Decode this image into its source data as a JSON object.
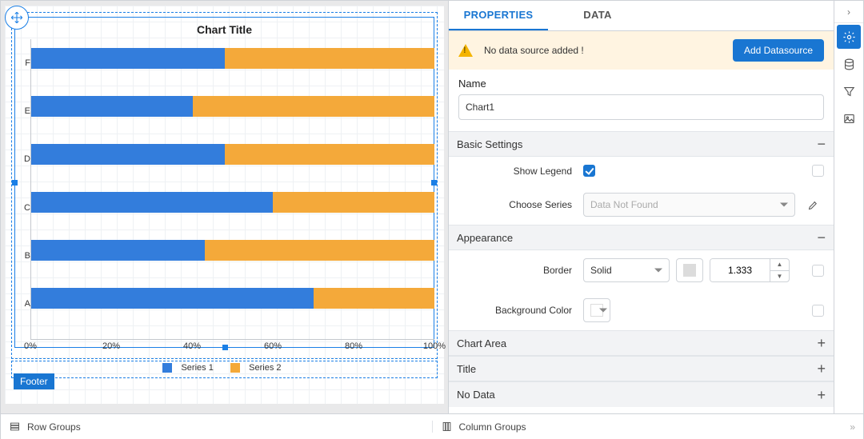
{
  "tabs": {
    "properties": "PROPERTIES",
    "data": "DATA"
  },
  "alert": {
    "message": "No data source added !",
    "button": "Add Datasource"
  },
  "name_section": {
    "label": "Name",
    "value": "Chart1"
  },
  "sections": {
    "basic": "Basic Settings",
    "appearance": "Appearance",
    "chart_area": "Chart Area",
    "title": "Title",
    "no_data": "No Data"
  },
  "basic": {
    "show_legend_label": "Show Legend",
    "choose_series_label": "Choose Series",
    "series_placeholder": "Data Not Found"
  },
  "appearance": {
    "border_label": "Border",
    "border_style": "Solid",
    "border_width": "1.333",
    "bg_label": "Background Color"
  },
  "footer_tag": "Footer",
  "bottom": {
    "row_groups": "Row Groups",
    "col_groups": "Column Groups"
  },
  "chart_data": {
    "type": "bar",
    "title": "Chart Title",
    "orientation": "horizontal",
    "stacked": true,
    "normalized_100_percent": true,
    "xlabel": "",
    "ylabel": "",
    "xlim": [
      0,
      100
    ],
    "x_ticks": [
      "0%",
      "20%",
      "40%",
      "60%",
      "80%",
      "100%"
    ],
    "categories": [
      "A",
      "B",
      "C",
      "D",
      "E",
      "F"
    ],
    "series": [
      {
        "name": "Series 1",
        "color": "#337ddc",
        "values": [
          70,
          43,
          60,
          48,
          40,
          48
        ]
      },
      {
        "name": "Series 2",
        "color": "#f4a93a",
        "values": [
          30,
          57,
          40,
          52,
          60,
          52
        ]
      }
    ],
    "legend_position": "bottom"
  }
}
